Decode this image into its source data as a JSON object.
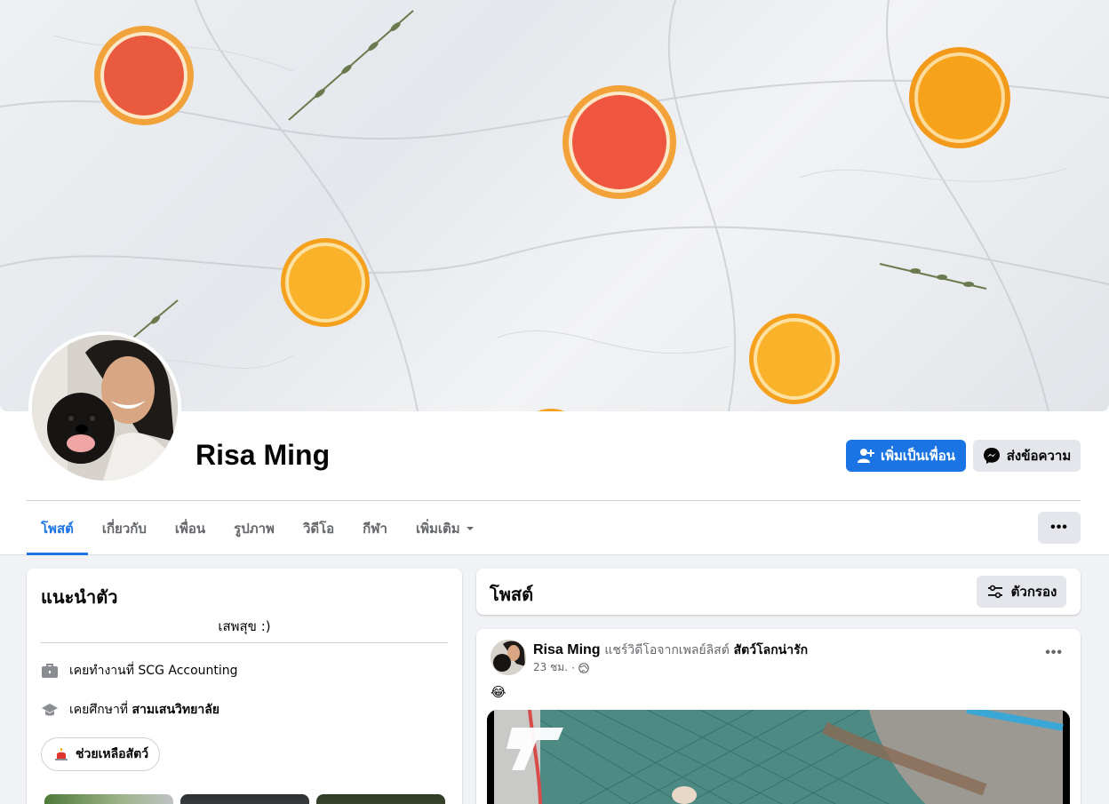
{
  "profile": {
    "name": "Risa Ming",
    "add_friend_label": "เพิ่มเป็นเพื่อน",
    "message_label": "ส่งข้อความ"
  },
  "tabs": [
    {
      "label": "โพสต์",
      "active": true
    },
    {
      "label": "เกี่ยวกับ"
    },
    {
      "label": "เพื่อน"
    },
    {
      "label": "รูปภาพ"
    },
    {
      "label": "วิดีโอ"
    },
    {
      "label": "กีฬา"
    },
    {
      "label": "เพิ่มเติม"
    }
  ],
  "more_menu_label": "•••",
  "intro": {
    "title": "แนะนำตัว",
    "bio": "เสพสุข :)",
    "work_prefix": "เคยทำงานที่",
    "work_place": "SCG Accounting",
    "study_prefix": "เคยศึกษาที่",
    "study_place": "สามเสนวิทยาลัย",
    "hobby_label": "ช่วยเหลือสัตว์"
  },
  "posts_section": {
    "title": "โพสต์",
    "filter_label": "ตัวกรอง"
  },
  "post": {
    "author": "Risa Ming",
    "verb": "แชร์วิดีโอจากเพลย์ลิสต์",
    "playlist": "สัตว์โลกน่ารัก",
    "time": "23 ชม.",
    "separator": "·",
    "emoji": "😂",
    "menu_label": "•••"
  },
  "colors": {
    "accent": "#1b74e4",
    "page_bg": "#f0f2f5",
    "secondary_button": "#e4e6eb"
  },
  "icons": [
    "add-friend-icon",
    "messenger-icon",
    "chevron-down-icon",
    "briefcase-icon",
    "graduation-cap-icon",
    "rescue-siren-icon",
    "filter-icon",
    "globe-icon"
  ]
}
